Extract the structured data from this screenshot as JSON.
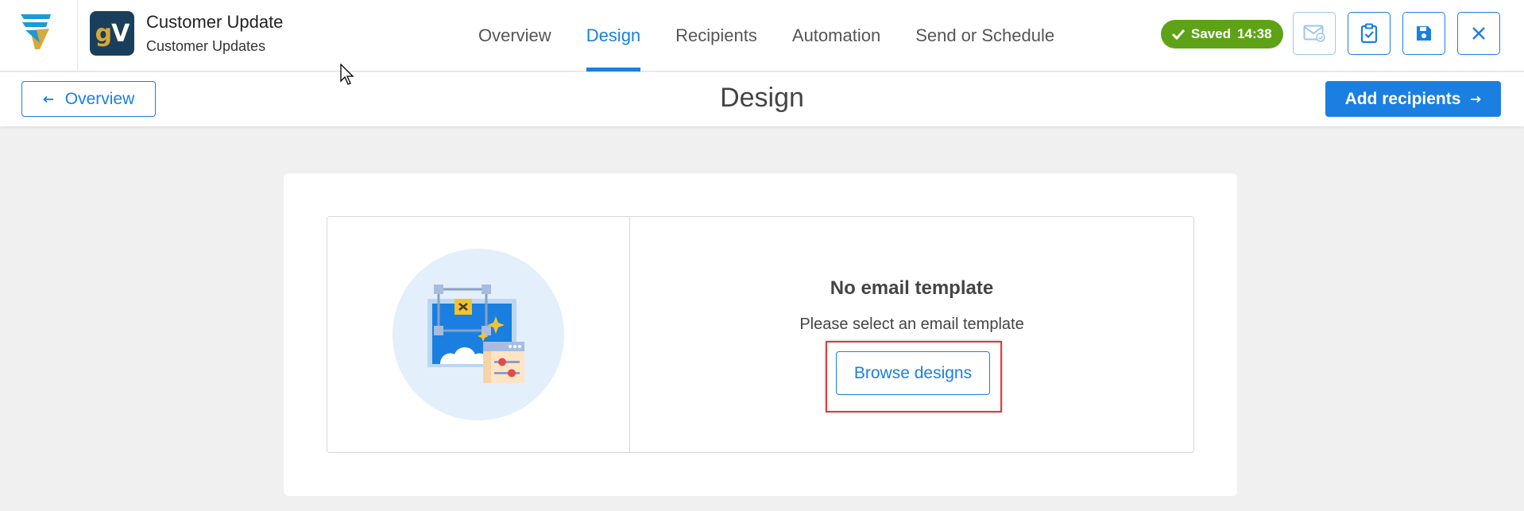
{
  "header": {
    "title": "Customer Update",
    "subtitle": "Customer Updates",
    "avatar_text_g": "g",
    "avatar_text_v": "V",
    "tabs": [
      {
        "label": "Overview",
        "active": false
      },
      {
        "label": "Design",
        "active": true
      },
      {
        "label": "Recipients",
        "active": false
      },
      {
        "label": "Automation",
        "active": false
      },
      {
        "label": "Send or Schedule",
        "active": false
      }
    ],
    "saved_label": "Saved",
    "saved_time": "14:38"
  },
  "subheader": {
    "back_label": "Overview",
    "page_title": "Design",
    "next_label": "Add recipients"
  },
  "empty_state": {
    "title": "No email template",
    "message": "Please select an email template",
    "button_label": "Browse designs"
  },
  "icons": {
    "logo": "brand-logo-icon",
    "mail": "mail-check-icon",
    "checklist": "clipboard-check-icon",
    "save": "floppy-disk-icon",
    "close": "close-icon",
    "back": "arrow-left-icon",
    "next": "arrow-right-icon",
    "check": "checkmark-icon"
  },
  "colors": {
    "accent": "#1a7fe0",
    "saved_badge": "#5ea317",
    "highlight": "#e23a3a",
    "avatar_bg": "#1a3f5c"
  }
}
